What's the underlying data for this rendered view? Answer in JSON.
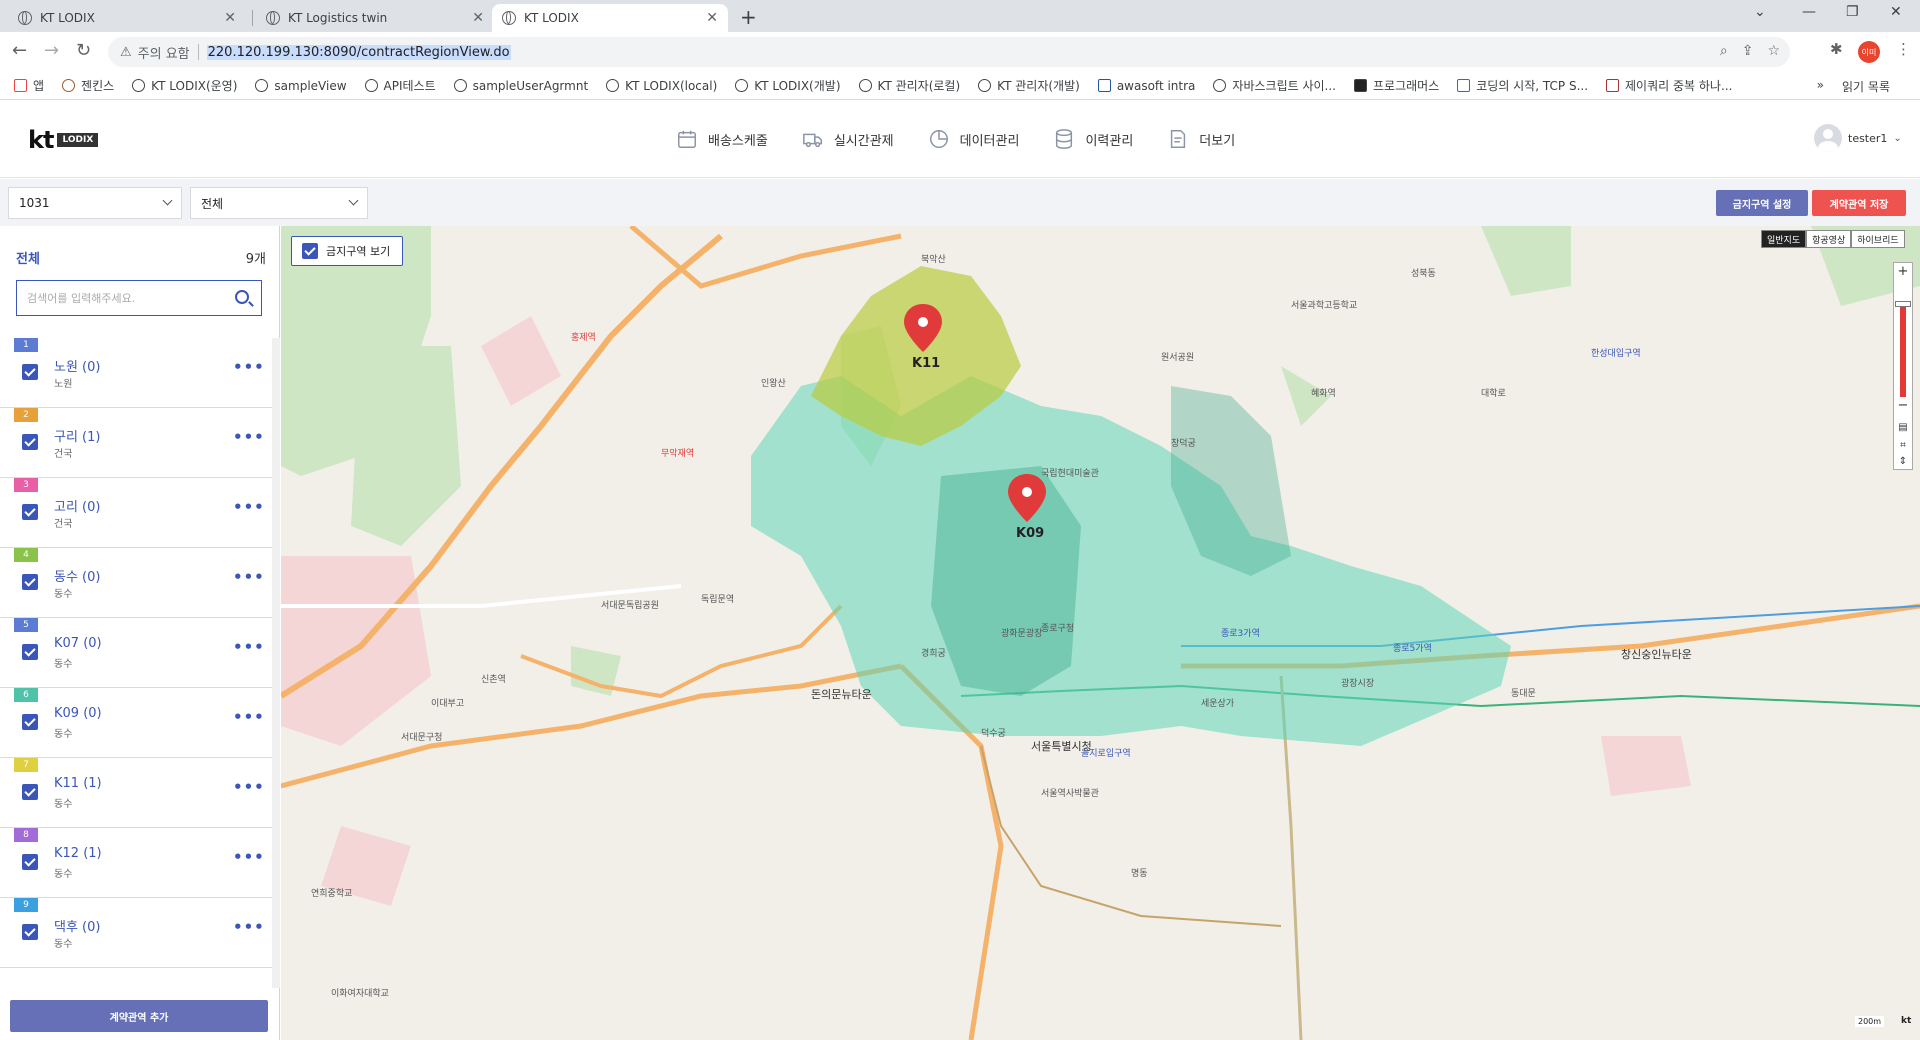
{
  "browser": {
    "tabs": [
      {
        "title": "KT LODIX",
        "active": false
      },
      {
        "title": "KT Logistics twin",
        "active": false
      },
      {
        "title": "KT LODIX",
        "active": true
      }
    ],
    "security_warning": "주의 요함",
    "url": "220.120.199.130:8090/contractRegionView.do",
    "profile_badge": "이미",
    "bookmarks": [
      "앱",
      "젠킨스",
      "KT LODIX(운영)",
      "sampleView",
      "API테스트",
      "sampleUserAgrmnt",
      "KT LODIX(local)",
      "KT LODIX(개발)",
      "KT 관리자(로컬)",
      "KT 관리자(개발)",
      "awasoft intra",
      "자바스크립트 사이...",
      "프로그래머스",
      "코딩의 시작, TCP S...",
      "제이쿼리 중복 하나..."
    ],
    "reading_list": "읽기 목록",
    "overflow": "»"
  },
  "header": {
    "logo_text": "kt",
    "logo_badge": "LODIX",
    "nav": [
      {
        "label": "배송스케줄",
        "icon": "calendar-icon"
      },
      {
        "label": "실시간관제",
        "icon": "truck-icon"
      },
      {
        "label": "데이터관리",
        "icon": "pie-chart-icon"
      },
      {
        "label": "이력관리",
        "icon": "database-icon"
      },
      {
        "label": "더보기",
        "icon": "document-icon"
      }
    ],
    "user_name": "tester1"
  },
  "filters": {
    "contract_select": "1031",
    "type_select": "전체",
    "no_go_zone_button": "금지구역 설정",
    "save_button": "계약관역 저장"
  },
  "sidebar": {
    "all_label": "전체",
    "count": "9개",
    "search_placeholder": "검색어를 입력해주세요.",
    "items": [
      {
        "num": "1",
        "name": "노원 (0)",
        "sub": "노원",
        "color": "#5b7bd5"
      },
      {
        "num": "2",
        "name": "구리 (1)",
        "sub": "건국",
        "color": "#e8a13a"
      },
      {
        "num": "3",
        "name": "고리 (0)",
        "sub": "건국",
        "color": "#e85fa5"
      },
      {
        "num": "4",
        "name": "동수 (0)",
        "sub": "동수",
        "color": "#8bc34a"
      },
      {
        "num": "5",
        "name": "K07 (0)",
        "sub": "동수",
        "color": "#5b7bd5"
      },
      {
        "num": "6",
        "name": "K09 (0)",
        "sub": "동수",
        "color": "#4fc3a8"
      },
      {
        "num": "7",
        "name": "K11 (1)",
        "sub": "동수",
        "color": "#e0d040"
      },
      {
        "num": "8",
        "name": "K12 (1)",
        "sub": "동수",
        "color": "#a36bd8"
      },
      {
        "num": "9",
        "name": "댁후 (0)",
        "sub": "동수",
        "color": "#3aa0e0"
      }
    ],
    "add_button": "계약관역 추가"
  },
  "map": {
    "show_no_go_label": "금지구역 보기",
    "map_types": [
      "일반지도",
      "항공영상",
      "하이브리드"
    ],
    "markers": [
      {
        "label": "K11"
      },
      {
        "label": "K09"
      }
    ],
    "labels": [
      "서대문구청",
      "서울특별시청",
      "광화문광장",
      "종로구청",
      "국립현대미술관",
      "신촌역",
      "이대부고",
      "창덕궁",
      "원서공원",
      "서울과학고등학교",
      "종로5가역",
      "종로3가역",
      "광장시장",
      "동대문",
      "세운상가",
      "을지로입구역",
      "명동",
      "덕수궁",
      "서울역사박물관",
      "독립문역",
      "홍제역",
      "무악재역",
      "서대문독립공원",
      "연희중학교",
      "인왕산",
      "북악산",
      "성북동",
      "대학로",
      "혜화역",
      "창신숭인뉴타운",
      "한성대입구역",
      "이화여자대학교",
      "돈의문뉴타운",
      "경희궁"
    ],
    "scale": "200m",
    "scale_logo": "kt"
  }
}
